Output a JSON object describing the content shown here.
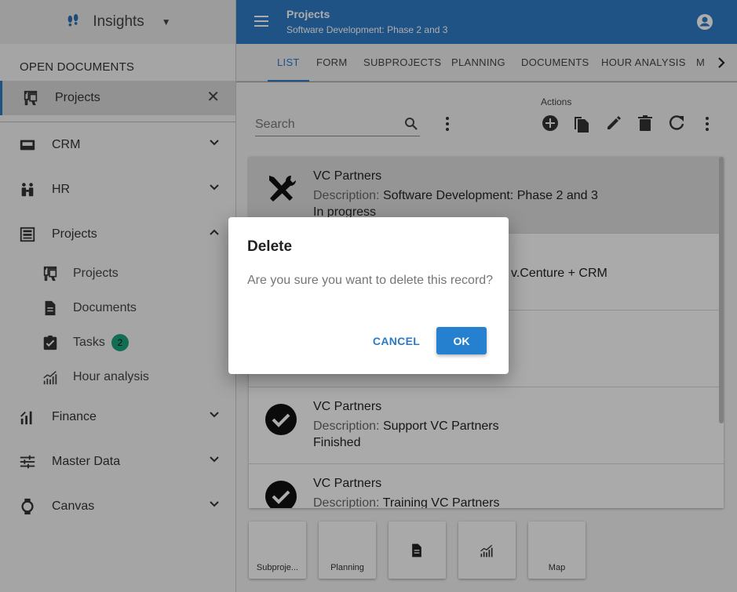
{
  "app": {
    "name": "Insights"
  },
  "sidebar": {
    "open_documents_label": "OPEN DOCUMENTS",
    "open_document": {
      "label": "Projects"
    },
    "nav": [
      {
        "label": "CRM",
        "icon": "crm-icon",
        "expanded": false
      },
      {
        "label": "HR",
        "icon": "hr-icon",
        "expanded": false
      },
      {
        "label": "Projects",
        "icon": "projects-icon",
        "expanded": true
      },
      {
        "label": "Finance",
        "icon": "finance-icon",
        "expanded": false
      },
      {
        "label": "Master Data",
        "icon": "master-data-icon",
        "expanded": false
      },
      {
        "label": "Canvas",
        "icon": "canvas-icon",
        "expanded": false
      }
    ],
    "projects_sub": [
      {
        "label": "Projects",
        "icon": "presentation-icon"
      },
      {
        "label": "Documents",
        "icon": "document-icon"
      },
      {
        "label": "Tasks",
        "icon": "task-check-icon",
        "badge": "2"
      },
      {
        "label": "Hour analysis",
        "icon": "trend-chart-icon"
      }
    ]
  },
  "header": {
    "title": "Projects",
    "subtitle": "Software Development: Phase 2 and 3"
  },
  "tabs": [
    {
      "label": "LIST",
      "active": true
    },
    {
      "label": "FORM"
    },
    {
      "label": "SUBPROJECTS"
    },
    {
      "label": "PLANNING"
    },
    {
      "label": "DOCUMENTS"
    },
    {
      "label": "HOUR ANALYSIS"
    },
    {
      "label": "M"
    }
  ],
  "toolbar": {
    "actions_label": "Actions",
    "search_placeholder": "Search"
  },
  "records": [
    {
      "title": "VC Partners",
      "desc_label": "Description:",
      "desc": "Software Development: Phase 2 and 3",
      "status": "In progress",
      "icon": "tools-icon"
    },
    {
      "fragment": "v.Centure + CRM"
    },
    {
      "title": "VC Partners",
      "desc_label": "Description:",
      "desc": "Support VC Partners",
      "status": "Finished",
      "icon": "check-circle-icon"
    },
    {
      "title": "VC Partners",
      "desc_label": "Description:",
      "desc": "Training VC Partners",
      "icon": "check-circle-icon"
    }
  ],
  "tiles": [
    {
      "label": "Subproje..."
    },
    {
      "label": "Planning"
    },
    {
      "label": "",
      "icon": "document-icon"
    },
    {
      "label": "",
      "icon": "trend-chart-icon"
    },
    {
      "label": "Map"
    }
  ],
  "dialog": {
    "title": "Delete",
    "message": "Are you sure you want to delete this record?",
    "cancel_label": "CANCEL",
    "ok_label": "OK"
  },
  "colors": {
    "primary": "#2e7bc6",
    "badge": "#1aa37a"
  }
}
